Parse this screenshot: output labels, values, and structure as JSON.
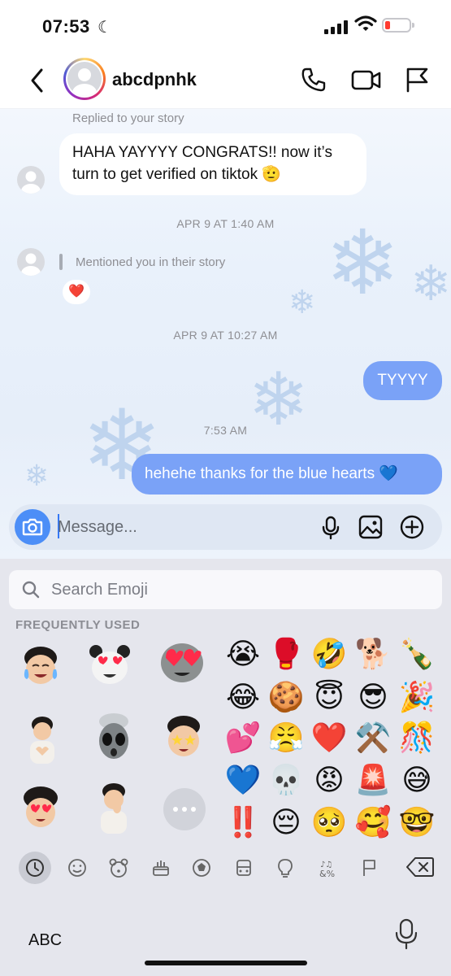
{
  "status_bar": {
    "time": "07:53",
    "moon_icon": "moon-icon",
    "battery_color": "#ff3b30"
  },
  "header": {
    "username": "abcdpnhk",
    "icons": [
      "back-chevron-icon",
      "phone-icon",
      "video-camera-icon",
      "flag-icon"
    ]
  },
  "messages": {
    "reply_note": "Replied to your story",
    "msg1_line1": "HAHA YAYYYY CONGRATS!! now it’s",
    "msg1_line2": "turn to get verified on tiktok 🫡",
    "ts1": "APR 9 AT 1:40 AM",
    "mention_note": "Mentioned you in their story",
    "reaction": "❤️",
    "ts2": "APR 9 AT 10:27 AM",
    "out1": "TYYYY",
    "ts3": "7:53 AM",
    "out2": "hehehe thanks for the blue hearts 💙",
    "outgoing_color": "#7aa2f7"
  },
  "composer": {
    "placeholder": "Message...",
    "icons": [
      "camera-icon",
      "microphone-icon",
      "gallery-icon",
      "add-circle-icon"
    ]
  },
  "emoji_keyboard": {
    "search_placeholder": "Search Emoji",
    "section_title": "FREQUENTLY USED",
    "emoji_rows": [
      [
        "😭",
        "🥊",
        "🤣",
        "🐕",
        "🍾"
      ],
      [
        "😂",
        "🍪",
        "😇",
        "😎",
        "🎉"
      ],
      [
        "💕",
        "😤",
        "❤️",
        "⚒️",
        "🎊"
      ],
      [
        "💙",
        "💀",
        "😡",
        "🚨",
        "😅"
      ],
      [
        "‼️",
        "😔",
        "🥺",
        "🥰",
        "🤓"
      ]
    ],
    "categories": [
      "recent-icon",
      "smiley-icon",
      "animal-icon",
      "food-icon",
      "ball-icon",
      "travel-icon",
      "bulb-icon",
      "symbols-icon",
      "flag-icon"
    ],
    "abc_label": "ABC",
    "dictation_icon": "microphone-icon",
    "backspace_icon": "backspace-icon"
  }
}
